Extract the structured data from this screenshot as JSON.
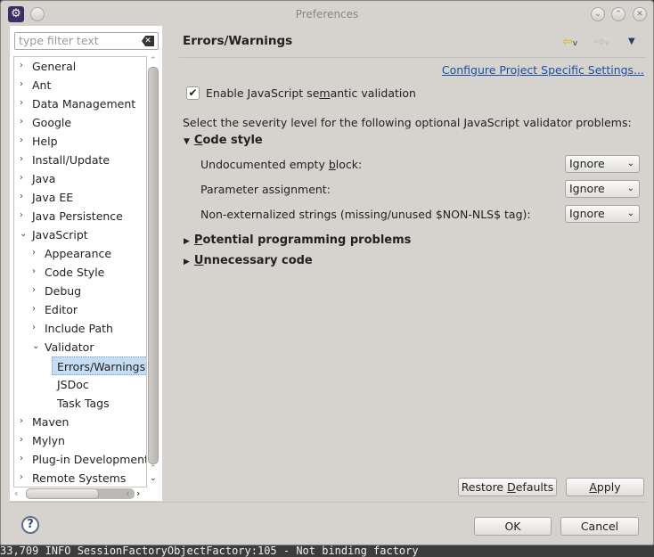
{
  "window": {
    "title": "Preferences"
  },
  "filter": {
    "placeholder": "type filter text"
  },
  "tree": [
    {
      "label": "General",
      "level": 0,
      "expand": "collapsed"
    },
    {
      "label": "Ant",
      "level": 0,
      "expand": "collapsed"
    },
    {
      "label": "Data Management",
      "level": 0,
      "expand": "collapsed"
    },
    {
      "label": "Google",
      "level": 0,
      "expand": "collapsed"
    },
    {
      "label": "Help",
      "level": 0,
      "expand": "collapsed"
    },
    {
      "label": "Install/Update",
      "level": 0,
      "expand": "collapsed"
    },
    {
      "label": "Java",
      "level": 0,
      "expand": "collapsed"
    },
    {
      "label": "Java EE",
      "level": 0,
      "expand": "collapsed"
    },
    {
      "label": "Java Persistence",
      "level": 0,
      "expand": "collapsed"
    },
    {
      "label": "JavaScript",
      "level": 0,
      "expand": "expanded"
    },
    {
      "label": "Appearance",
      "level": 1,
      "expand": "collapsed"
    },
    {
      "label": "Code Style",
      "level": 1,
      "expand": "collapsed"
    },
    {
      "label": "Debug",
      "level": 1,
      "expand": "collapsed"
    },
    {
      "label": "Editor",
      "level": 1,
      "expand": "collapsed"
    },
    {
      "label": "Include Path",
      "level": 1,
      "expand": "collapsed"
    },
    {
      "label": "Validator",
      "level": 1,
      "expand": "expanded"
    },
    {
      "label": "Errors/Warnings",
      "level": 2,
      "expand": "none",
      "selected": true
    },
    {
      "label": "JSDoc",
      "level": 2,
      "expand": "none"
    },
    {
      "label": "Task Tags",
      "level": 2,
      "expand": "none"
    },
    {
      "label": "Maven",
      "level": 0,
      "expand": "collapsed"
    },
    {
      "label": "Mylyn",
      "level": 0,
      "expand": "collapsed"
    },
    {
      "label": "Plug-in Development",
      "level": 0,
      "expand": "collapsed"
    },
    {
      "label": "Remote Systems",
      "level": 0,
      "expand": "collapsed"
    }
  ],
  "page": {
    "title": "Errors/Warnings",
    "configure_link": "Configure Project Specific Settings...",
    "enable_label_pre": "Enable JavaScript se",
    "enable_label_m": "m",
    "enable_label_post": "antic validation",
    "enable_checked": true,
    "instructions": "Select the severity level for the following optional JavaScript validator problems:",
    "sections": [
      {
        "label": "Code style",
        "u": "C",
        "rest": "ode style",
        "expanded": true
      },
      {
        "label": "Potential programming problems",
        "u": "P",
        "rest": "otential programming problems",
        "expanded": false
      },
      {
        "label": "Unnecessary code",
        "u": "U",
        "rest": "nnecessary code",
        "expanded": false
      }
    ],
    "options": [
      {
        "pre": "Undocumented empty ",
        "u": "b",
        "post": "lock:",
        "value": "Ignore"
      },
      {
        "pre": "Parameter assignment:",
        "u": "",
        "post": "",
        "value": "Ignore"
      },
      {
        "pre": "Non-externalized strings (missing/unused $NON-NLS$ tag):",
        "u": "",
        "post": "",
        "value": "Ignore"
      }
    ]
  },
  "buttons": {
    "restore_pre": "Restore ",
    "restore_u": "D",
    "restore_post": "efaults",
    "apply_u": "A",
    "apply_post": "pply",
    "ok": "OK",
    "cancel": "Cancel"
  },
  "background_log": "33,709  INFO SessionFactoryObjectFactory:105 - Not binding factory",
  "colors": {
    "link": "#1a4fa8",
    "selection": "#c6dcf2",
    "back_arrow": "#e8b400"
  }
}
